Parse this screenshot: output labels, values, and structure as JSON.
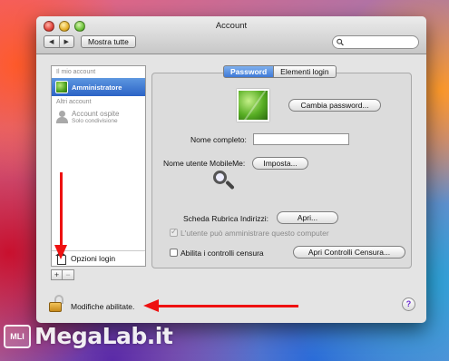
{
  "window": {
    "title": "Account"
  },
  "toolbar": {
    "back": "◀",
    "forward": "▶",
    "show_all": "Mostra tutte",
    "search_value": ""
  },
  "sidebar": {
    "my_account_header": "Il mio account",
    "admin_name": "Amministratore",
    "other_accounts_header": "Altri account",
    "guest_name": "Account ospite",
    "guest_sub": "Solo condivisione",
    "login_options": "Opzioni login",
    "add_label": "+",
    "remove_label": "−"
  },
  "tabs": {
    "password": "Password",
    "login_items": "Elementi login"
  },
  "form": {
    "change_password": "Cambia password...",
    "full_name_label": "Nome completo:",
    "full_name_value": "",
    "mobileme_label": "Nome utente MobileMe:",
    "mobileme_button": "Imposta...",
    "address_book_label": "Scheda Rubrica Indirizzi:",
    "address_book_button": "Apri...",
    "admin_check_label": "L'utente può amministrare questo computer",
    "parental_label": "Abilita i controlli censura",
    "parental_button": "Apri Controlli Censura..."
  },
  "bottom": {
    "lock_text": "Modifiche abilitate.",
    "help": "?"
  },
  "watermark": {
    "badge": "MLI",
    "text": "MegaLab.it"
  },
  "colors": {
    "accent": "#3f7ad7",
    "arrows": "#ee1111",
    "help_icon": "#6a2ad0"
  }
}
